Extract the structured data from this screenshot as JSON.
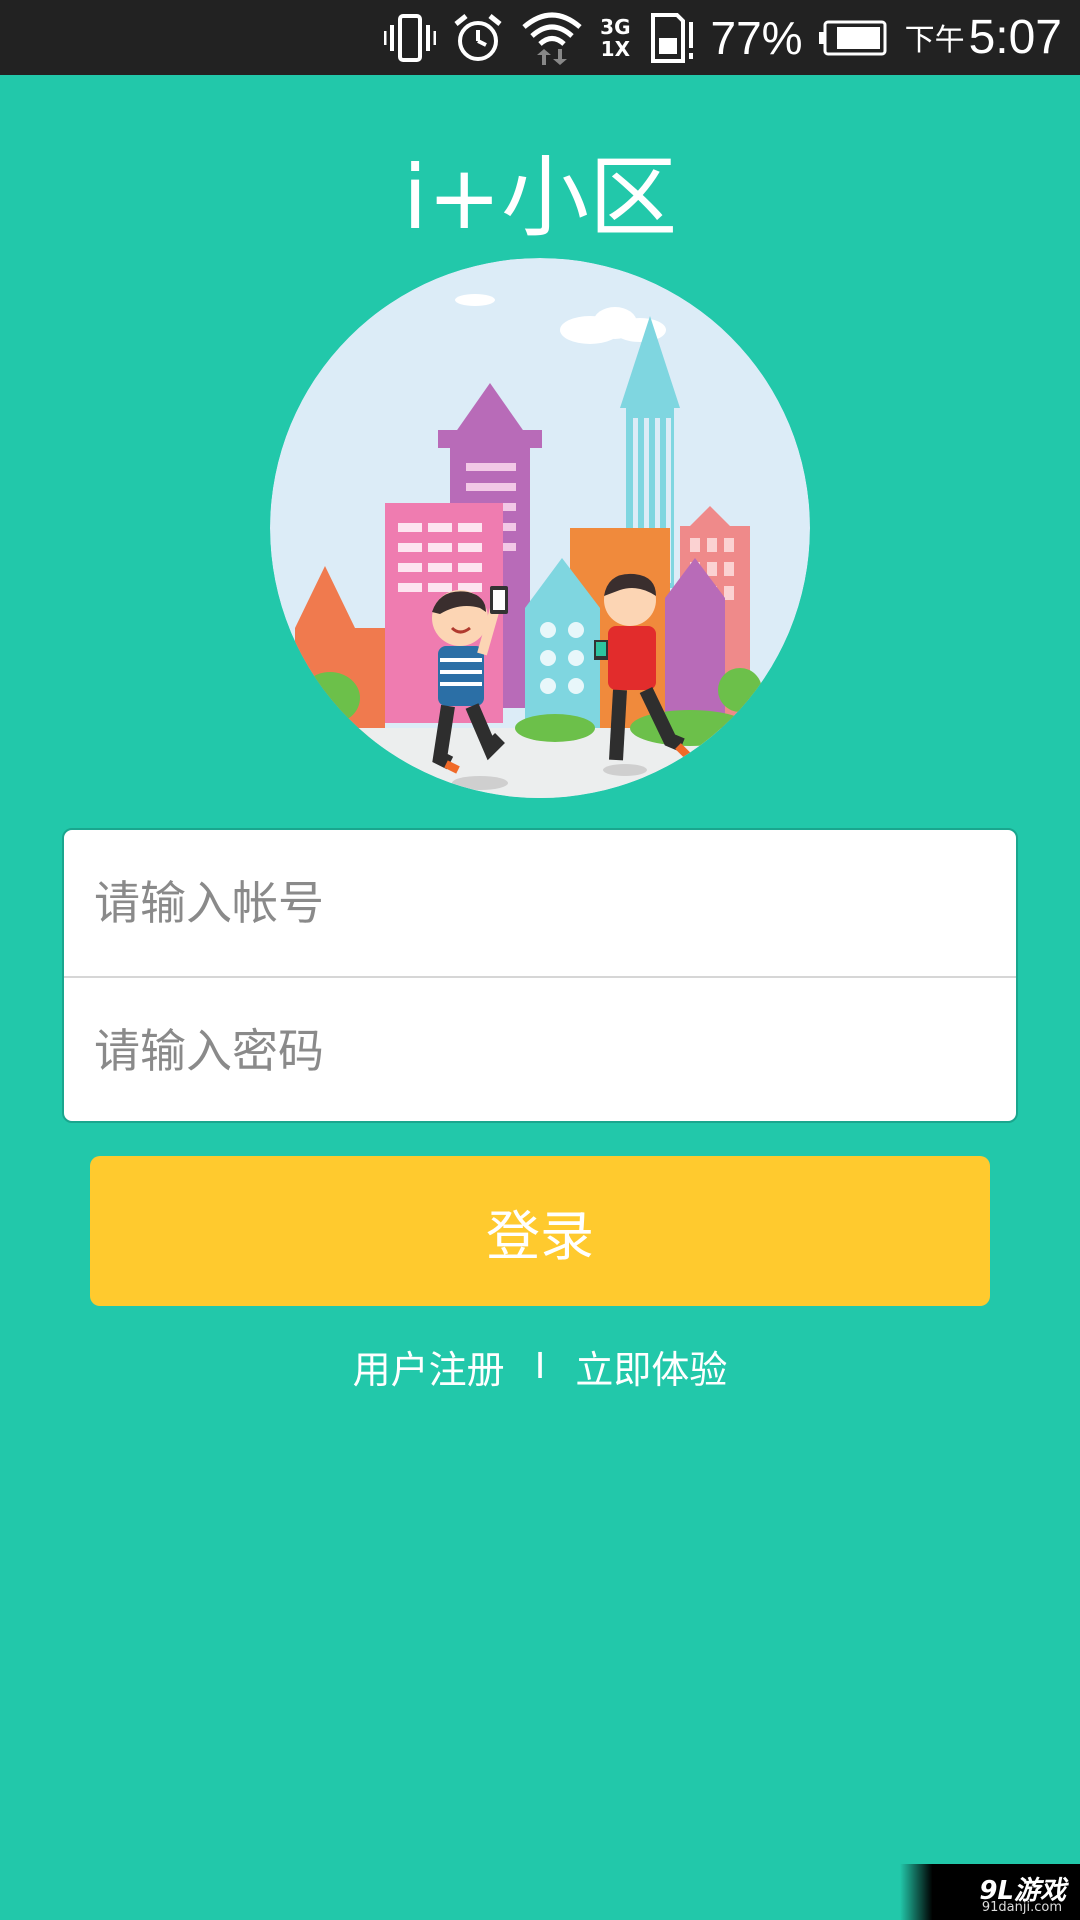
{
  "status_bar": {
    "battery_percent": "77%",
    "ampm": "下午",
    "time": "5:07",
    "network_label_top": "3G",
    "network_label_bottom": "1X",
    "icons": [
      "vibrate-icon",
      "alarm-icon",
      "wifi-icon",
      "cellular-signal-icon",
      "sim-card-icon",
      "battery-icon"
    ]
  },
  "app": {
    "title": "i+小区"
  },
  "login_form": {
    "account_placeholder": "请输入帐号",
    "password_placeholder": "请输入密码",
    "login_button": "登录"
  },
  "links": {
    "register": "用户注册",
    "separator": "I",
    "try_now": "立即体验"
  },
  "watermark": {
    "logo": "9L游戏",
    "url": "91danji.com"
  },
  "colors": {
    "background": "#22c8aa",
    "button": "#ffca2e",
    "status_bar": "#222222"
  }
}
